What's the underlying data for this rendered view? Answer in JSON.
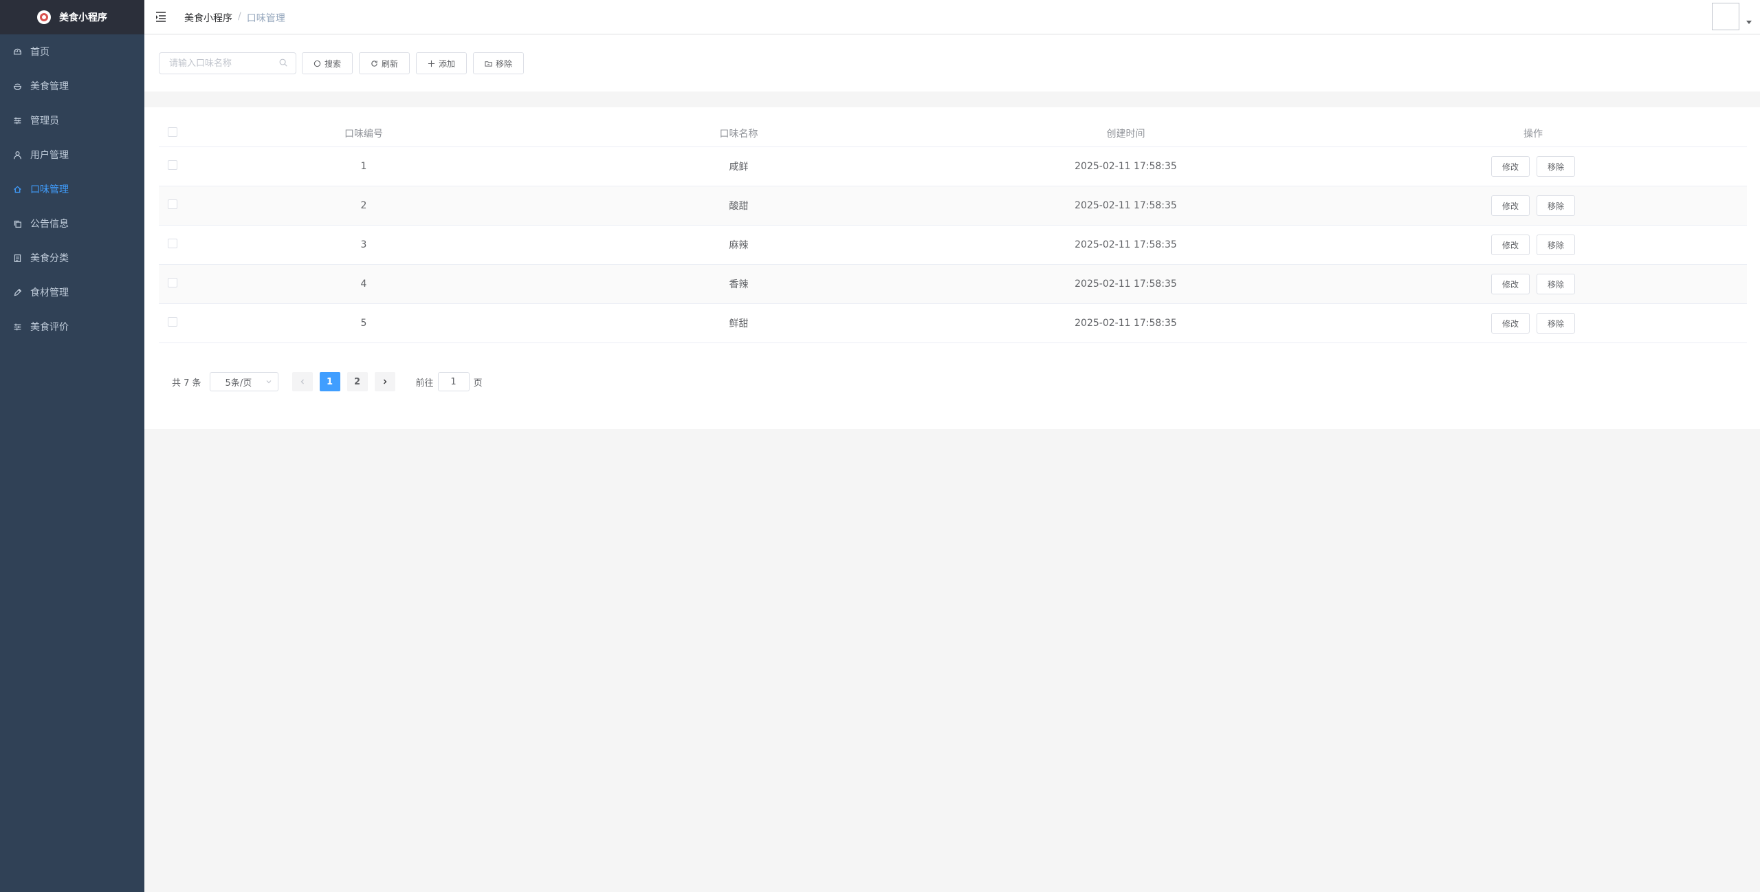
{
  "app": {
    "title": "美食小程序"
  },
  "sidebar": {
    "items": [
      {
        "label": "首页",
        "icon": "dashboard-icon",
        "active": false
      },
      {
        "label": "美食管理",
        "icon": "food-icon",
        "active": false
      },
      {
        "label": "管理员",
        "icon": "sliders-icon",
        "active": false
      },
      {
        "label": "用户管理",
        "icon": "user-icon",
        "active": false
      },
      {
        "label": "口味管理",
        "icon": "home-icon",
        "active": true
      },
      {
        "label": "公告信息",
        "icon": "copy-icon",
        "active": false
      },
      {
        "label": "美食分类",
        "icon": "document-icon",
        "active": false
      },
      {
        "label": "食材管理",
        "icon": "edit-icon",
        "active": false
      },
      {
        "label": "美食评价",
        "icon": "sliders-icon",
        "active": false
      }
    ]
  },
  "header": {
    "breadcrumb_root": "美食小程序",
    "breadcrumb_sep": "/",
    "breadcrumb_current": "口味管理"
  },
  "search": {
    "placeholder": "请输入口味名称",
    "value": "",
    "search_label": "搜索",
    "refresh_label": "刷新",
    "add_label": "添加",
    "remove_label": "移除"
  },
  "table": {
    "headers": {
      "id": "口味编号",
      "name": "口味名称",
      "time": "创建时间",
      "ops": "操作"
    },
    "edit_label": "修改",
    "remove_label": "移除",
    "rows": [
      {
        "id": "1",
        "name": "咸鲜",
        "time": "2025-02-11 17:58:35"
      },
      {
        "id": "2",
        "name": "酸甜",
        "time": "2025-02-11 17:58:35"
      },
      {
        "id": "3",
        "name": "麻辣",
        "time": "2025-02-11 17:58:35"
      },
      {
        "id": "4",
        "name": "香辣",
        "time": "2025-02-11 17:58:35"
      },
      {
        "id": "5",
        "name": "鲜甜",
        "time": "2025-02-11 17:58:35"
      }
    ]
  },
  "pagination": {
    "total": "共 7 条",
    "page_size": "5条/页",
    "pages": [
      "1",
      "2"
    ],
    "current_page": "1",
    "jump_prefix": "前往",
    "jump_value": "1",
    "jump_suffix": "页"
  },
  "colors": {
    "sidebar_bg": "#304156",
    "brand_bg": "#2b2f3a",
    "accent": "#409eff",
    "menu_text": "#bfcbd9"
  }
}
